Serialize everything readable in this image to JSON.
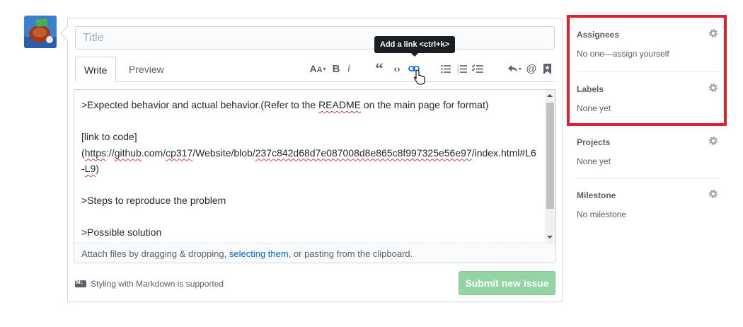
{
  "form": {
    "title_placeholder": "Title",
    "tabs": [
      "Write",
      "Preview"
    ],
    "tooltip": "Add a link <ctrl+k>",
    "toolbar_icons": [
      "text-size-icon",
      "bold-icon",
      "italic-icon",
      "quote-icon",
      "code-icon",
      "link-icon",
      "unordered-list-icon",
      "ordered-list-icon",
      "task-list-icon",
      "reply-icon",
      "mention-icon",
      "bookmark-icon"
    ],
    "editor_lines": {
      "l1a": ">Expected behavior and actual behavior.(Refer to the ",
      "l1b": "README",
      "l1c": " on the main page for format)",
      "l2": "[link to code]",
      "l3a": "(",
      "l3b": "https",
      "l3c": "://",
      "l3d": "github",
      "l3e": ".com/",
      "l3f": "cp317",
      "l3g": "/Website/blob/",
      "l3h": "237c842d68d7e087008d8e865c8f997325e56e97",
      "l3i": "/index.html#L6",
      "l4a": "-",
      "l4b": "L9",
      "l4c": ")",
      "l5": ">Steps to reproduce the problem",
      "l6": ">Possible solution"
    },
    "attach": {
      "before": "Attach files by dragging & dropping, ",
      "link": "selecting them",
      "after": ", or pasting from the clipboard."
    },
    "markdown_note": "Styling with Markdown is supported",
    "submit_label": "Submit new issue"
  },
  "sidebar": {
    "sections": [
      {
        "heading": "Assignees",
        "value": "No one—assign yourself"
      },
      {
        "heading": "Labels",
        "value": "None yet"
      },
      {
        "heading": "Projects",
        "value": "None yet"
      },
      {
        "heading": "Milestone",
        "value": "No milestone"
      }
    ]
  },
  "colors": {
    "accent": "#0366d6",
    "submit": "#94d3a2",
    "highlight": "#e0202d"
  }
}
